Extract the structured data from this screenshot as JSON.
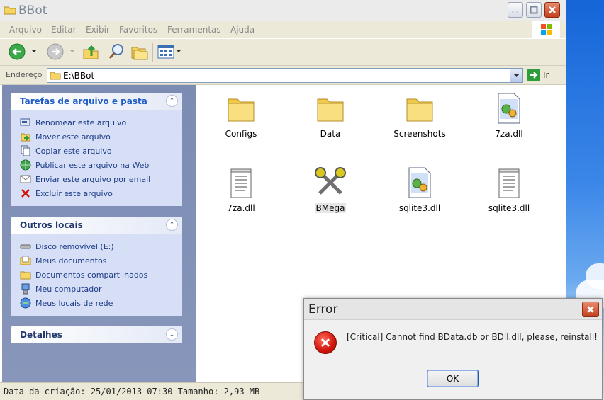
{
  "window": {
    "title": "BBot"
  },
  "menu": [
    "Arquivo",
    "Editar",
    "Exibir",
    "Favoritos",
    "Ferramentas",
    "Ajuda"
  ],
  "address": {
    "label": "Endereço",
    "path": "E:\\BBot",
    "go_label": "Ir"
  },
  "tasks_panel": {
    "title": "Tarefas de arquivo e pasta",
    "items": [
      {
        "label": "Renomear este arquivo",
        "icon": "rename-icon"
      },
      {
        "label": "Mover este arquivo",
        "icon": "move-icon"
      },
      {
        "label": "Copiar este arquivo",
        "icon": "copy-icon"
      },
      {
        "label": "Publicar este arquivo na Web",
        "icon": "web-publish-icon"
      },
      {
        "label": "Enviar este arquivo por email",
        "icon": "email-icon"
      },
      {
        "label": "Excluir este arquivo",
        "icon": "delete-icon"
      }
    ]
  },
  "places_panel": {
    "title": "Outros locais",
    "items": [
      {
        "label": "Disco removível (E:)",
        "icon": "removable-disk-icon"
      },
      {
        "label": "Meus documentos",
        "icon": "my-documents-icon"
      },
      {
        "label": "Documentos compartilhados",
        "icon": "shared-folder-icon"
      },
      {
        "label": "Meu computador",
        "icon": "computer-icon"
      },
      {
        "label": "Meus locais de rede",
        "icon": "network-icon"
      }
    ]
  },
  "details_panel": {
    "title": "Detalhes"
  },
  "files": [
    {
      "name": "Configs",
      "icon": "folder-icon"
    },
    {
      "name": "Data",
      "icon": "folder-icon"
    },
    {
      "name": "Screenshots",
      "icon": "folder-icon"
    },
    {
      "name": "7za.dll",
      "icon": "dll-icon"
    },
    {
      "name": "7za.dll",
      "icon": "text-file-icon"
    },
    {
      "name": "BMega",
      "icon": "app-icon",
      "selected": true
    },
    {
      "name": "sqlite3.dll",
      "icon": "dll-icon"
    },
    {
      "name": "sqlite3.dll",
      "icon": "text-file-icon"
    }
  ],
  "status": {
    "text": "Data da criação: 25/01/2013 07:30 Tamanho: 2,93 MB"
  },
  "dialog": {
    "title": "Error",
    "message": "[Critical] Cannot find BData.db or BDll.dll, please, reinstall!",
    "ok_label": "OK"
  }
}
